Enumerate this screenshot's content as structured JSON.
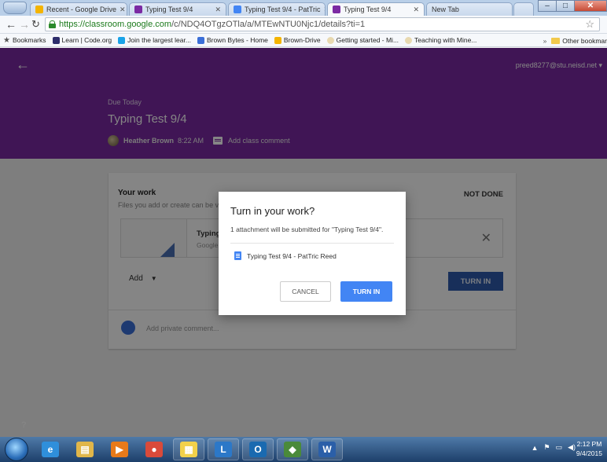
{
  "browser": {
    "tabs": [
      {
        "label": "Recent - Google Drive",
        "color": "#f4b400"
      },
      {
        "label": "Typing Test 9/4",
        "color": "#7b2aa3"
      },
      {
        "label": "Typing Test 9/4 - PatTric",
        "color": "#4285f4"
      },
      {
        "label": "Typing Test 9/4",
        "color": "#7b2aa3"
      },
      {
        "label": "New Tab",
        "color": ""
      }
    ],
    "url_host": "https://classroom.google.com",
    "url_path": "/c/NDQ4OTgzOTla/a/MTEwNTU0Njc1/details?ti=1",
    "bookmarks": [
      {
        "label": "Bookmarks",
        "color": "#555"
      },
      {
        "label": "Learn | Code.org",
        "color": "#2d2d6b"
      },
      {
        "label": "Join the largest lear...",
        "color": "#1aa3e8"
      },
      {
        "label": "Brown Bytes - Home",
        "color": "#3b6fd8"
      },
      {
        "label": "Brown-Drive",
        "color": "#f4b400"
      },
      {
        "label": "Getting started - Mi...",
        "color": "#e8d9b0"
      },
      {
        "label": "Teaching with Mine...",
        "color": "#e8d9b0"
      }
    ],
    "other_bookmarks": "Other bookmar"
  },
  "app": {
    "account": "preed8277@stu.neisd.net",
    "due_label": "Due Today",
    "assignment_title": "Typing Test 9/4",
    "author": "Heather Brown",
    "posted_time": "8:22 AM",
    "add_class_comment": "Add class comment",
    "accent": "#7b2aa3"
  },
  "work_card": {
    "title": "Your work",
    "hint": "Files you add or create can be v",
    "status": "NOT DONE",
    "attachment_name": "Typing Tes",
    "attachment_type": "Google Do",
    "add_label": "Add",
    "turn_in_label": "TURN IN",
    "private_comment_placeholder": "Add private comment..."
  },
  "dialog": {
    "title": "Turn in your work?",
    "body": "1 attachment will be submitted for \"Typing Test 9/4\".",
    "file_name": "Typing Test 9/4 - PatTric Reed",
    "cancel_label": "CANCEL",
    "confirm_label": "TURN IN",
    "confirm_color": "#4285f4"
  },
  "help_label": "?",
  "taskbar": {
    "apps": [
      {
        "name": "internet-explorer",
        "glyph": "e",
        "color": "#2f8fdb"
      },
      {
        "name": "file-explorer",
        "glyph": "▤",
        "color": "#e0b64a"
      },
      {
        "name": "media-player",
        "glyph": "▶",
        "color": "#e87a1a"
      },
      {
        "name": "chrome",
        "glyph": "●",
        "color": "#d94a3a"
      },
      {
        "name": "app-grid",
        "glyph": "▦",
        "color": "#f2d14a"
      },
      {
        "name": "lync",
        "glyph": "L",
        "color": "#2c78c8"
      },
      {
        "name": "outlook",
        "glyph": "O",
        "color": "#1a6ab0"
      },
      {
        "name": "minecraft",
        "glyph": "◆",
        "color": "#4a8a3a"
      },
      {
        "name": "word",
        "glyph": "W",
        "color": "#2b5fa8"
      }
    ],
    "clock_time": "2:12 PM",
    "clock_date": "9/4/2015"
  }
}
